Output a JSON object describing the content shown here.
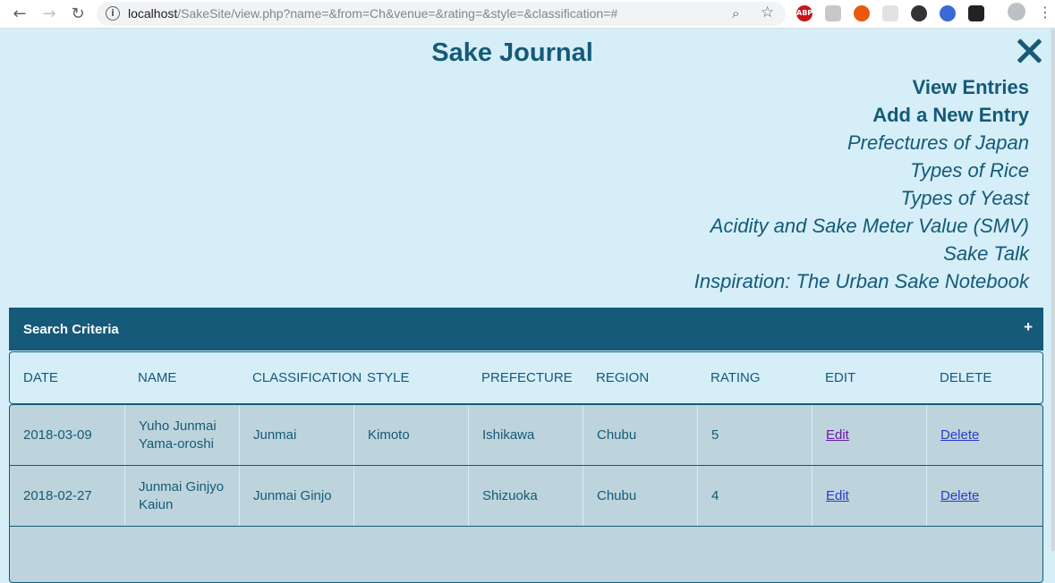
{
  "browser": {
    "url_host": "localhost",
    "url_path": "/SakeSite/view.php?name=&from=Ch&venue=&rating=&style=&classification=#",
    "ext_abp": "ABP"
  },
  "site": {
    "title": "Sake Journal"
  },
  "menu": {
    "items": [
      "View Entries",
      "Add a New Entry",
      "Prefectures of Japan",
      "Types of Rice",
      "Types of Yeast",
      "Acidity and Sake Meter Value (SMV)",
      "Sake Talk",
      "Inspiration: The Urban Sake Notebook"
    ]
  },
  "search": {
    "label": "Search Criteria",
    "toggle": "+"
  },
  "table": {
    "headers": [
      "DATE",
      "NAME",
      "CLASSIFICATION",
      "STYLE",
      "PREFECTURE",
      "REGION",
      "RATING",
      "EDIT",
      "DELETE"
    ],
    "rows": [
      {
        "date": "2018-03-09",
        "name": "Yuho Junmai Yama-oroshi",
        "classification": "Junmai",
        "style": "Kimoto",
        "prefecture": "Ishikawa",
        "region": "Chubu",
        "rating": "5",
        "edit": "Edit",
        "delete": "Delete"
      },
      {
        "date": "2018-02-27",
        "name": "Junmai Ginjyo Kaiun",
        "classification": "Junmai Ginjo",
        "style": "",
        "prefecture": "Shizuoka",
        "region": "Chubu",
        "rating": "4",
        "edit": "Edit",
        "delete": "Delete"
      }
    ]
  }
}
